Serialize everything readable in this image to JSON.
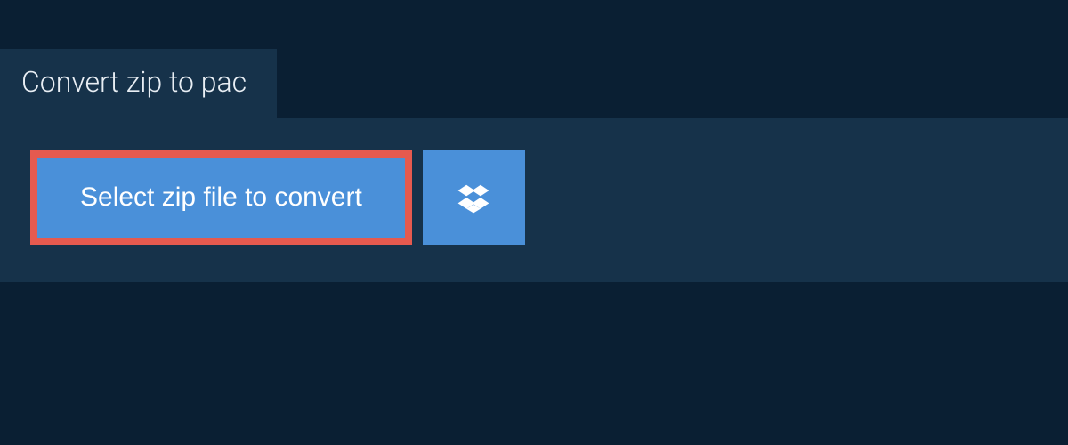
{
  "tab": {
    "title": "Convert zip to pac"
  },
  "actions": {
    "select_file_label": "Select zip file to convert"
  },
  "colors": {
    "background": "#0a1f33",
    "panel": "#16324a",
    "button": "#4a90d9",
    "highlight": "#e55a4f",
    "text_light": "#ffffff"
  }
}
